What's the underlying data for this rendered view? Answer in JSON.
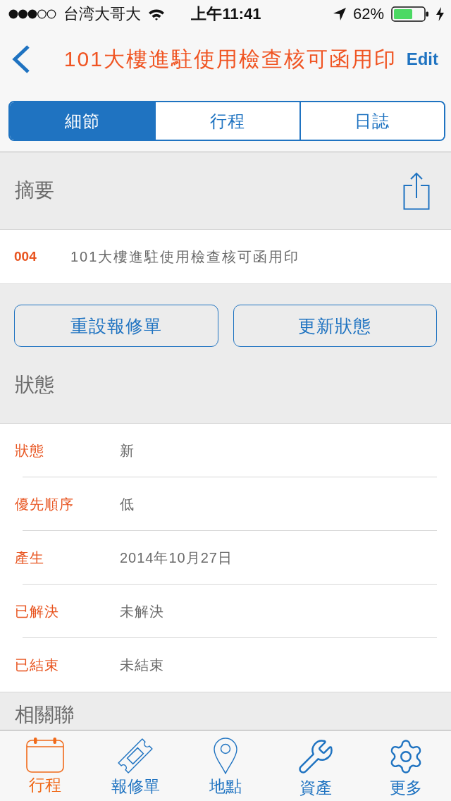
{
  "status_bar": {
    "carrier": "台湾大哥大",
    "time": "上午11:41",
    "battery": "62%"
  },
  "nav_bar": {
    "title": "101大樓進駐使用檢查核可函用印",
    "edit": "Edit"
  },
  "segments": [
    {
      "label": "細節",
      "selected": true
    },
    {
      "label": "行程",
      "selected": false
    },
    {
      "label": "日誌",
      "selected": false
    }
  ],
  "summary": {
    "heading": "摘要",
    "number": "004",
    "text": "101大樓進駐使用檢查核可函用印"
  },
  "actions": [
    "重設報修單",
    "更新狀態"
  ],
  "status": {
    "heading": "狀態",
    "fields": [
      {
        "label": "狀態",
        "value": "新"
      },
      {
        "label": "優先順序",
        "value": "低"
      },
      {
        "label": "產生",
        "value": "2014年10月27日"
      },
      {
        "label": "已解決",
        "value": "未解決"
      },
      {
        "label": "已結束",
        "value": "未結束"
      }
    ]
  },
  "related": {
    "heading": "相關聯"
  },
  "tab_bar": [
    {
      "label": "行程",
      "selected": true
    },
    {
      "label": "報修單",
      "selected": false
    },
    {
      "label": "地點",
      "selected": false
    },
    {
      "label": "資產",
      "selected": false
    },
    {
      "label": "更多",
      "selected": false
    }
  ]
}
